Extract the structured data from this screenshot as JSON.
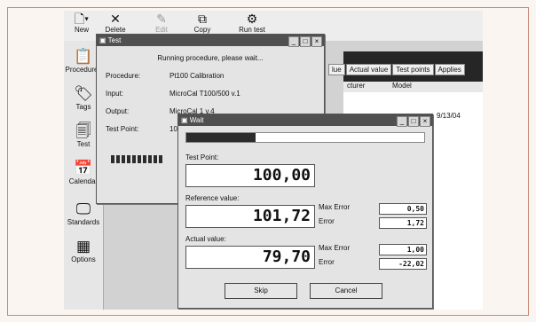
{
  "toolbar": {
    "buttons": [
      {
        "label": "New",
        "icon": "document-icon"
      },
      {
        "label": "Delete",
        "icon": "close-icon"
      },
      {
        "label": "Edit",
        "icon": "edit-icon"
      },
      {
        "label": "Copy",
        "icon": "copy-icon"
      },
      {
        "label": "Run test",
        "icon": "run-icon"
      }
    ]
  },
  "sidebar": {
    "items": [
      {
        "label": "Procedures",
        "icon": "clipboard-icon"
      },
      {
        "label": "Tags",
        "icon": "tag-icon"
      },
      {
        "label": "Test",
        "icon": "test-icon"
      },
      {
        "label": "Calendar",
        "icon": "calendar-icon"
      },
      {
        "label": "Standards",
        "icon": "monitor-icon"
      },
      {
        "label": "Options",
        "icon": "options-icon"
      }
    ]
  },
  "main": {
    "tabs": [
      "lue",
      "Actual value",
      "Test points",
      "Applies"
    ],
    "headers": [
      "cturer",
      "Model"
    ],
    "date_cell": "9/13/04"
  },
  "test_window": {
    "title": "Test",
    "status": "Running procedure, please wait...",
    "rows": [
      {
        "label": "Procedure:",
        "value": "Pt100 Calibration"
      },
      {
        "label": "Input:",
        "value": "MicroCal T100/500 v.1"
      },
      {
        "label": "Output:",
        "value": "MicroCal 1 v.4"
      },
      {
        "label": "Test Point:",
        "value": "10"
      }
    ],
    "progress": 0.6
  },
  "wait_window": {
    "title": "Wait",
    "progress": 0.29,
    "test_point_label": "Test Point:",
    "test_point": "100,00",
    "reference_label": "Reference value:",
    "reference": "101,72",
    "ref_max_error_label": "Max Error",
    "ref_max_error": "0,50",
    "ref_error_label": "Error",
    "ref_error": "1,72",
    "actual_label": "Actual value:",
    "actual": "79,70",
    "act_max_error_label": "Max Error",
    "act_max_error": "1,00",
    "act_error_label": "Error",
    "act_error": "-22,02",
    "skip_label": "Skip",
    "cancel_label": "Cancel"
  }
}
